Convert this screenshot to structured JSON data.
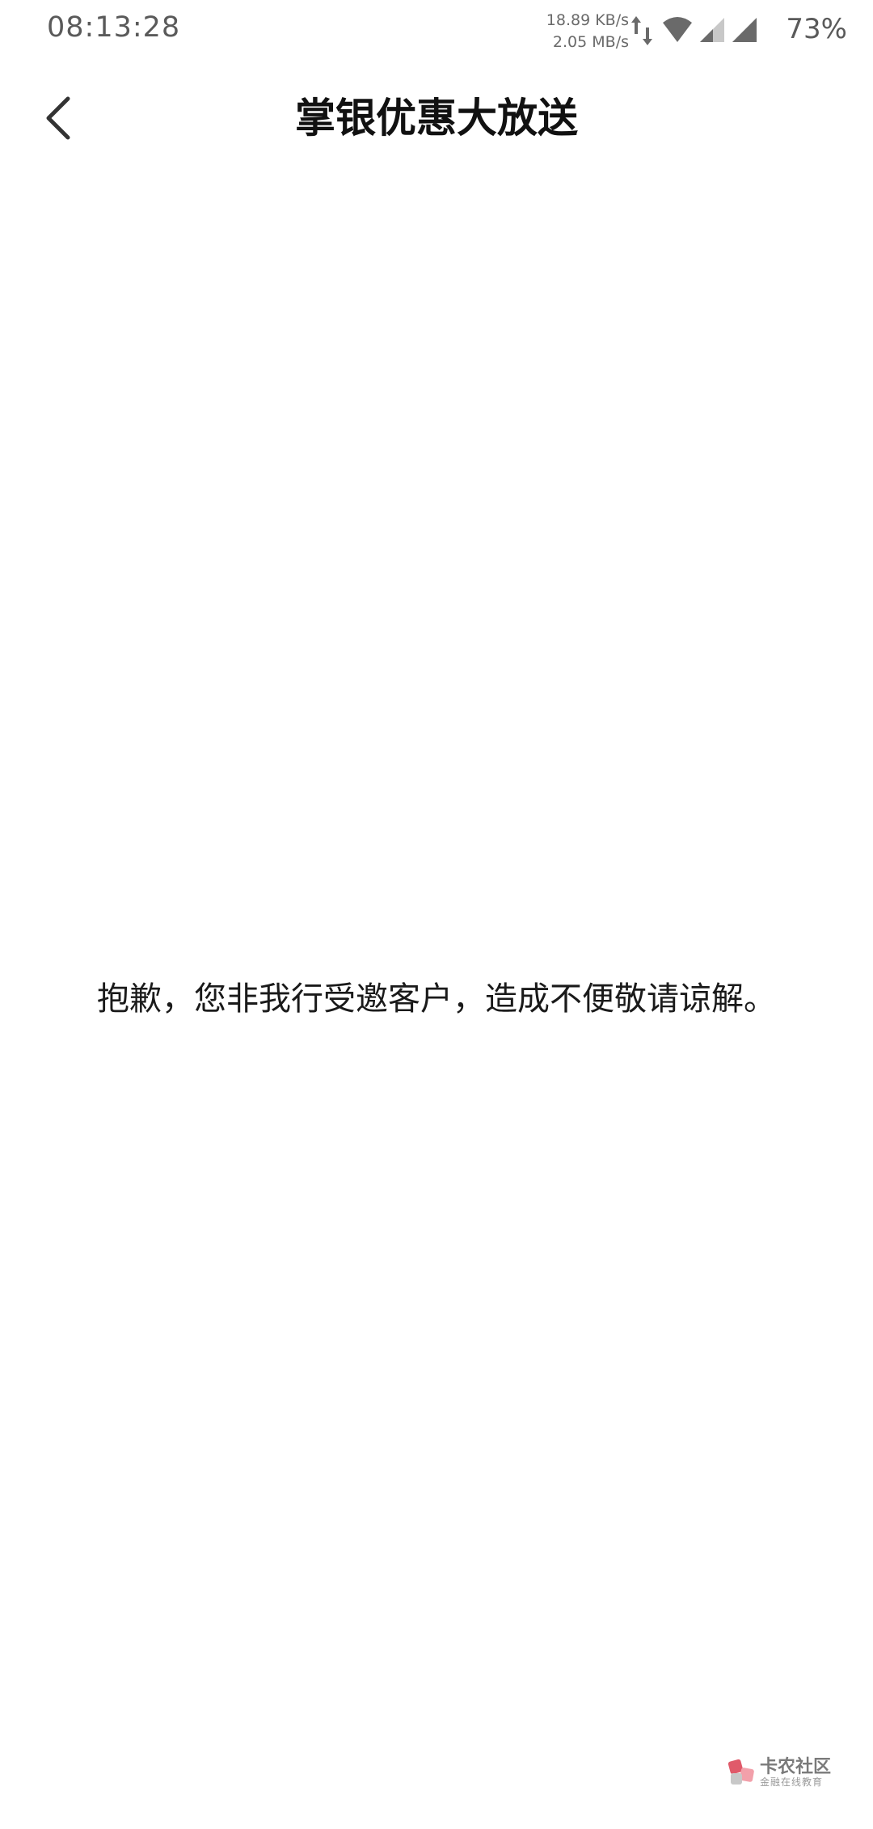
{
  "status_bar": {
    "time": "08:13:28",
    "upload_speed": "18.89 KB/s",
    "download_speed": "2.05 MB/s",
    "battery": "73%",
    "icon_color": "#6a6a6a",
    "icons": [
      "data-arrows-icon",
      "wifi-icon",
      "signal-icon",
      "signal-icon"
    ]
  },
  "header": {
    "title": "掌银优惠大放送",
    "back_icon": "chevron-left-icon"
  },
  "content": {
    "message": "抱歉，您非我行受邀客户，造成不便敬请谅解。"
  },
  "watermark": {
    "title": "卡农社区",
    "subtitle": "金融在线教育",
    "accent": "#e05a6a"
  }
}
